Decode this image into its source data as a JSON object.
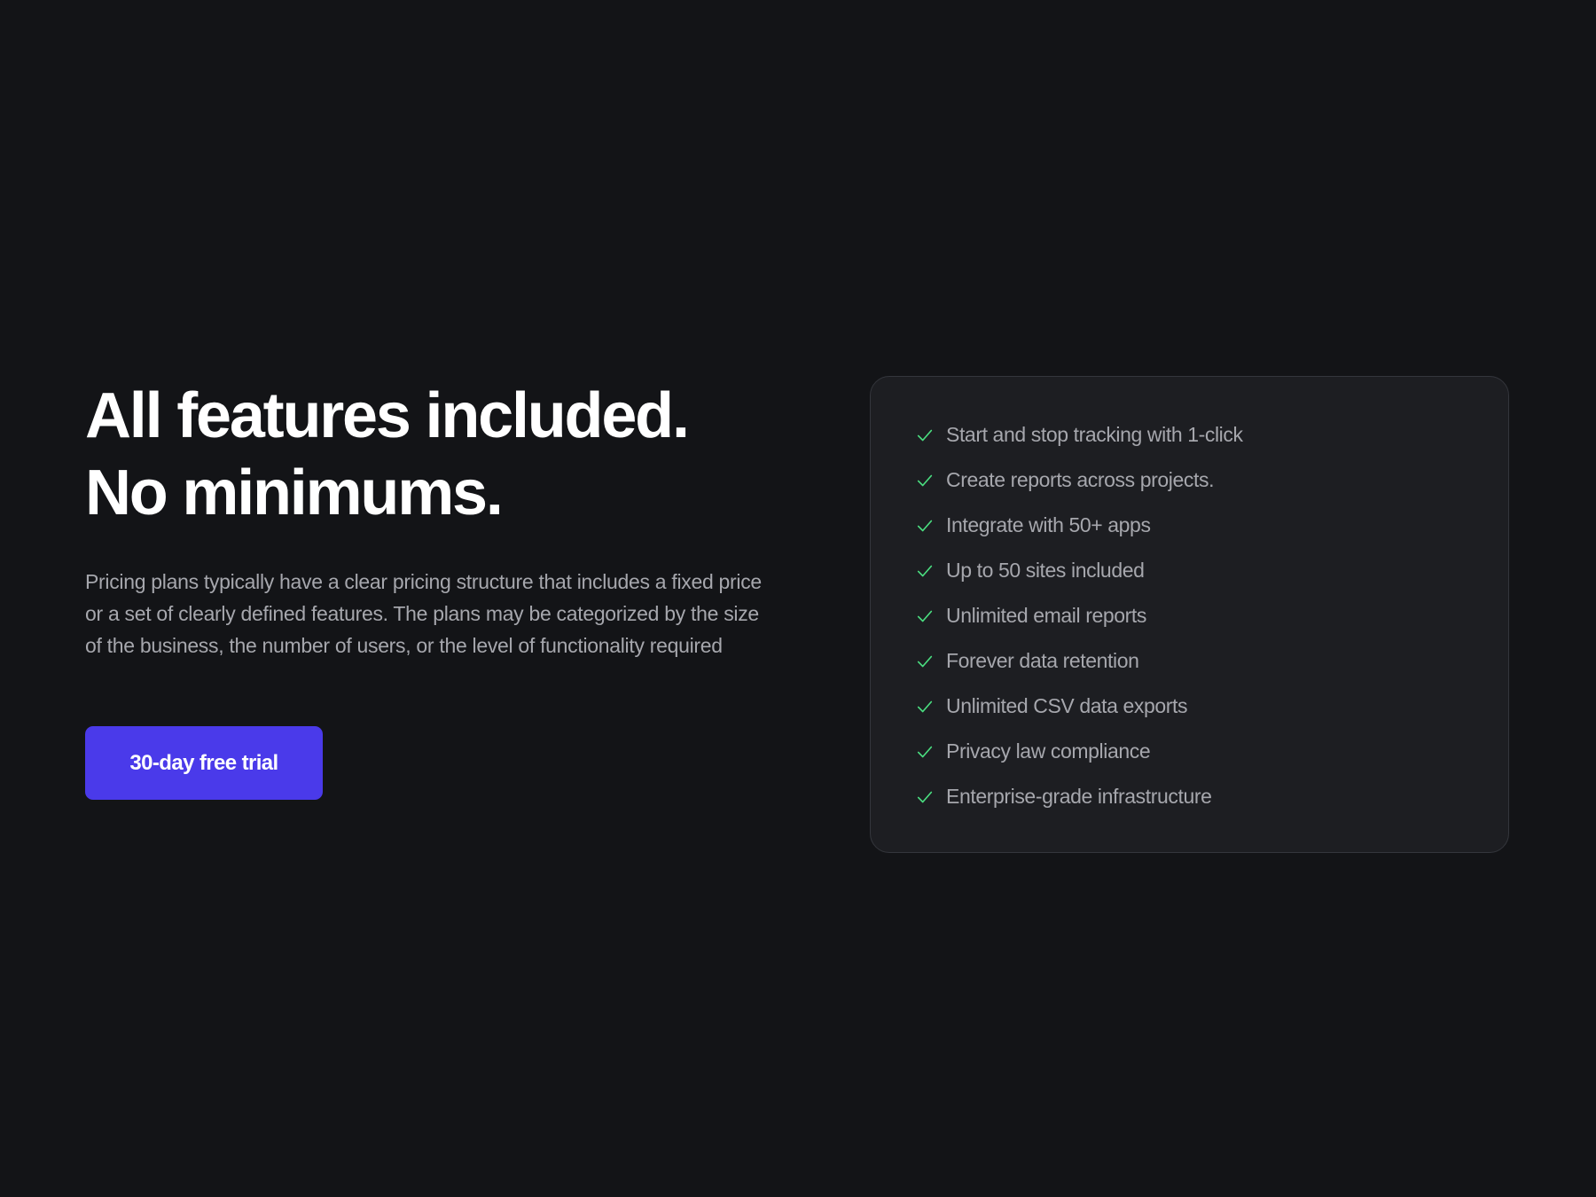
{
  "hero": {
    "headline_line1": "All features included.",
    "headline_line2": "No minimums.",
    "description": "Pricing plans typically have a clear pricing structure that includes a fixed price or a set of clearly defined features. The plans may be categorized by the size of the business, the number of users, or the level of functionality required",
    "cta_label": "30-day free trial"
  },
  "features": {
    "icon": "check-icon",
    "items": [
      "Start and stop tracking with 1-click",
      "Create reports across projects.",
      "Integrate with 50+ apps",
      "Up to 50 sites included",
      "Unlimited email reports",
      "Forever data retention",
      "Unlimited CSV data exports",
      "Privacy law compliance",
      "Enterprise-grade infrastructure"
    ]
  },
  "colors": {
    "background": "#131417",
    "card_background": "#1d1e22",
    "card_border": "#34363c",
    "accent": "#4a3aea",
    "check": "#4ade80",
    "muted_text": "#a6a7ad",
    "heading_text": "#ffffff"
  }
}
